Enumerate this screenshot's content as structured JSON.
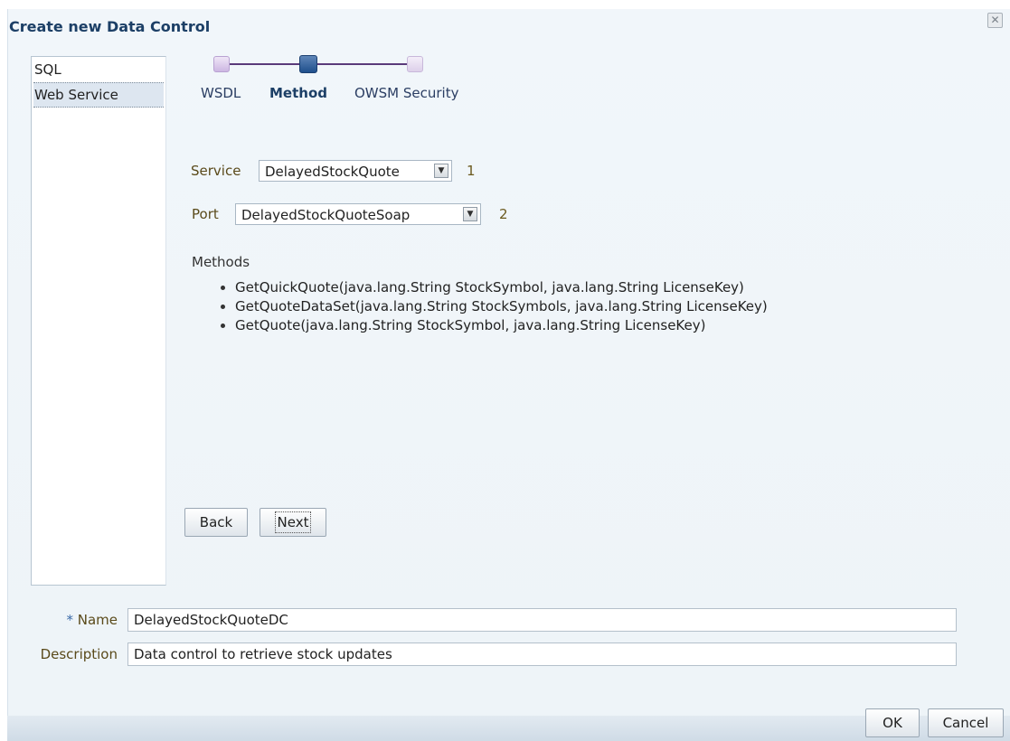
{
  "dialog": {
    "title": "Create new Data Control",
    "close_icon": "close-icon"
  },
  "type_list": {
    "items": [
      {
        "label": "SQL"
      },
      {
        "label": "Web Service"
      }
    ],
    "selected": "Web Service"
  },
  "train": {
    "steps": [
      {
        "label": "WSDL",
        "state": "visited"
      },
      {
        "label": "Method",
        "state": "current"
      },
      {
        "label": "OWSM Security",
        "state": "unvisited"
      }
    ]
  },
  "form": {
    "service": {
      "label": "Service",
      "value": "DelayedStockQuote",
      "number": "1"
    },
    "port": {
      "label": "Port",
      "value": "DelayedStockQuoteSoap",
      "number": "2"
    },
    "methods_label": "Methods",
    "methods": [
      "GetQuickQuote(java.lang.String StockSymbol, java.lang.String LicenseKey)",
      "GetQuoteDataSet(java.lang.String StockSymbols, java.lang.String LicenseKey)",
      "GetQuote(java.lang.String StockSymbol, java.lang.String LicenseKey)"
    ],
    "back_label": "Back",
    "next_label": "Next"
  },
  "fields": {
    "name": {
      "required_mark": "*",
      "label": "Name",
      "value": "DelayedStockQuoteDC"
    },
    "description": {
      "label": "Description",
      "value": "Data control to retrieve stock updates"
    }
  },
  "buttons": {
    "ok": "OK",
    "cancel": "Cancel"
  },
  "colors": {
    "title": "#1c3f66",
    "train_current": "#1f4f8c",
    "label_text": "#5a4a1a",
    "required": "#3a6aa8"
  }
}
